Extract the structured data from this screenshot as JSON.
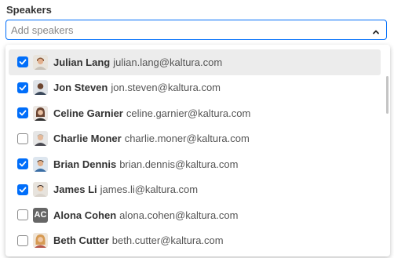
{
  "field": {
    "label": "Speakers",
    "placeholder": "Add speakers"
  },
  "options": [
    {
      "name": "Julian Lang",
      "email": "julian.lang@kaltura.com",
      "checked": true,
      "avatar": "person-photo-icon"
    },
    {
      "name": "Jon Steven",
      "email": "jon.steven@kaltura.com",
      "checked": true,
      "avatar": "person-photo-icon"
    },
    {
      "name": "Celine Garnier",
      "email": "celine.garnier@kaltura.com",
      "checked": true,
      "avatar": "person-photo-icon"
    },
    {
      "name": "Charlie Moner",
      "email": "charlie.moner@kaltura.com",
      "checked": false,
      "avatar": "person-photo-icon"
    },
    {
      "name": "Brian Dennis",
      "email": "brian.dennis@kaltura.com",
      "checked": true,
      "avatar": "person-photo-icon"
    },
    {
      "name": "James Li",
      "email": "james.li@kaltura.com",
      "checked": true,
      "avatar": "person-photo-icon"
    },
    {
      "name": "Alona Cohen",
      "email": "alona.cohen@kaltura.com",
      "checked": false,
      "avatar_initials": "AC"
    },
    {
      "name": "Beth Cutter",
      "email": "beth.cutter@kaltura.com",
      "checked": false,
      "avatar": "person-photo-icon"
    }
  ],
  "colors": {
    "accent": "#006efa",
    "highlight": "#ececec"
  }
}
